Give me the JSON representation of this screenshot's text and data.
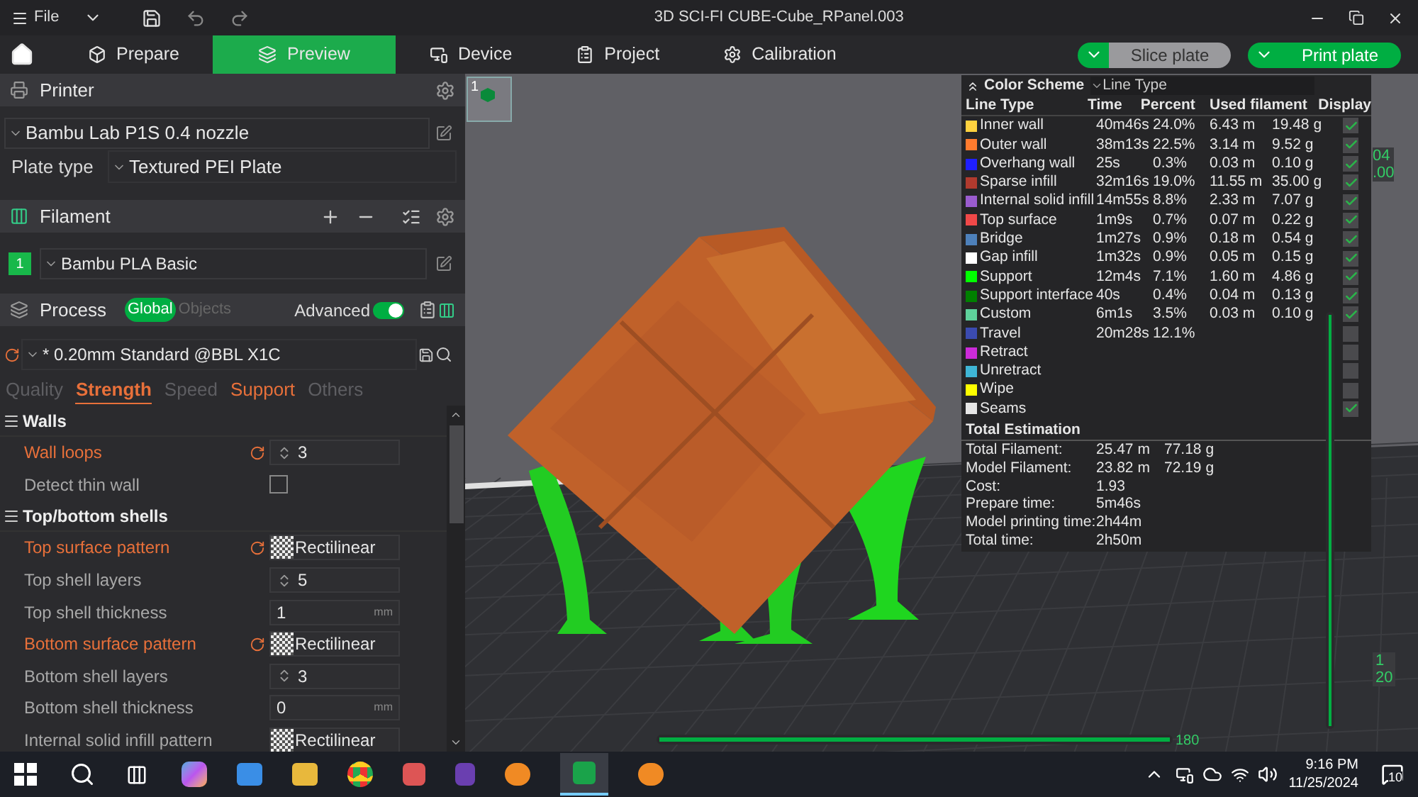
{
  "titlebar": {
    "menu": "File",
    "title": "3D SCI-FI CUBE-Cube_RPanel.003"
  },
  "tabs": [
    {
      "label": "Prepare",
      "selected": false
    },
    {
      "label": "Preview",
      "selected": true
    },
    {
      "label": "Device",
      "selected": false
    },
    {
      "label": "Project",
      "selected": false
    },
    {
      "label": "Calibration",
      "selected": false
    }
  ],
  "actions": [
    {
      "label": "Slice plate",
      "disabled": true
    },
    {
      "label": "Print plate",
      "disabled": false
    }
  ],
  "printer": {
    "title": "Printer",
    "model": "Bambu Lab P1S 0.4 nozzle",
    "plate_label": "Plate type",
    "plate_value": "Textured PEI Plate"
  },
  "filament": {
    "title": "Filament",
    "items": [
      {
        "index": "1",
        "name": "Bambu PLA Basic",
        "color": "#18b84a"
      }
    ]
  },
  "process": {
    "title": "Process",
    "scopes": [
      {
        "label": "Global",
        "selected": true
      },
      {
        "label": "Objects",
        "selected": false
      }
    ],
    "advanced_label": "Advanced",
    "advanced_on": true,
    "preset": "* 0.20mm Standard @BBL X1C"
  },
  "subtabs": [
    {
      "label": "Quality",
      "selected": false,
      "modified": false
    },
    {
      "label": "Strength",
      "selected": true,
      "modified": true
    },
    {
      "label": "Speed",
      "selected": false,
      "modified": false
    },
    {
      "label": "Support",
      "selected": false,
      "modified": true
    },
    {
      "label": "Others",
      "selected": false,
      "modified": false
    }
  ],
  "groups": [
    {
      "title": "Walls",
      "rows": [
        {
          "label": "Wall loops",
          "modified": true,
          "kind": "spin",
          "value": "3"
        },
        {
          "label": "Detect thin wall",
          "modified": false,
          "kind": "checkbox",
          "checked": false
        }
      ]
    },
    {
      "title": "Top/bottom shells",
      "rows": [
        {
          "label": "Top surface pattern",
          "modified": true,
          "kind": "pattern",
          "value": "Rectilinear"
        },
        {
          "label": "Top shell layers",
          "modified": false,
          "kind": "spin",
          "value": "5"
        },
        {
          "label": "Top shell thickness",
          "modified": false,
          "kind": "number",
          "value": "1",
          "unit": "mm"
        },
        {
          "label": "Bottom surface pattern",
          "modified": true,
          "kind": "pattern",
          "value": "Rectilinear"
        },
        {
          "label": "Bottom shell layers",
          "modified": false,
          "kind": "spin",
          "value": "3"
        },
        {
          "label": "Bottom shell thickness",
          "modified": false,
          "kind": "number",
          "value": "0",
          "unit": "mm"
        },
        {
          "label": "Internal solid infill pattern",
          "modified": false,
          "kind": "pattern",
          "value": "Rectilinear"
        }
      ]
    }
  ],
  "plate_thumb": {
    "label": "1"
  },
  "legend": {
    "title": "Color Scheme",
    "scheme": "Line Type",
    "columns": [
      "Line Type",
      "Time",
      "Percent",
      "Used filament",
      "Display"
    ],
    "rows": [
      {
        "name": "Inner wall",
        "color": "#ffd23f",
        "time": "40m46s",
        "percent": "24.0%",
        "length": "6.43 m",
        "weight": "19.48 g",
        "display": true
      },
      {
        "name": "Outer wall",
        "color": "#ff7b2e",
        "time": "38m13s",
        "percent": "22.5%",
        "length": "3.14 m",
        "weight": "9.52 g",
        "display": true
      },
      {
        "name": "Overhang wall",
        "color": "#1f1fff",
        "time": "25s",
        "percent": "0.3%",
        "length": "0.03 m",
        "weight": "0.10 g",
        "display": true
      },
      {
        "name": "Sparse infill",
        "color": "#b03a2e",
        "time": "32m16s",
        "percent": "19.0%",
        "length": "11.55 m",
        "weight": "35.00 g",
        "display": true
      },
      {
        "name": "Internal solid infill",
        "color": "#9a5ccf",
        "time": "14m55s",
        "percent": "8.8%",
        "length": "2.33 m",
        "weight": "7.07 g",
        "display": true
      },
      {
        "name": "Top surface",
        "color": "#f04848",
        "time": "1m9s",
        "percent": "0.7%",
        "length": "0.07 m",
        "weight": "0.22 g",
        "display": true
      },
      {
        "name": "Bridge",
        "color": "#4d80ba",
        "time": "1m27s",
        "percent": "0.9%",
        "length": "0.18 m",
        "weight": "0.54 g",
        "display": true
      },
      {
        "name": "Gap infill",
        "color": "#ffffff",
        "time": "1m32s",
        "percent": "0.9%",
        "length": "0.05 m",
        "weight": "0.15 g",
        "display": true
      },
      {
        "name": "Support",
        "color": "#00ff00",
        "time": "12m4s",
        "percent": "7.1%",
        "length": "1.60 m",
        "weight": "4.86 g",
        "display": true
      },
      {
        "name": "Support interface",
        "color": "#008000",
        "time": "40s",
        "percent": "0.4%",
        "length": "0.04 m",
        "weight": "0.13 g",
        "display": true
      },
      {
        "name": "Custom",
        "color": "#5ed19b",
        "time": "6m1s",
        "percent": "3.5%",
        "length": "0.03 m",
        "weight": "0.10 g",
        "display": true
      },
      {
        "name": "Travel",
        "color": "#3b4bb0",
        "time": "20m28s",
        "percent": "12.1%",
        "display": false
      },
      {
        "name": "Retract",
        "color": "#cc2bd9",
        "display": false
      },
      {
        "name": "Unretract",
        "color": "#3fb6d6",
        "display": false
      },
      {
        "name": "Wipe",
        "color": "#ffff00",
        "display": false
      },
      {
        "name": "Seams",
        "color": "#e6e6e6",
        "display": true
      }
    ],
    "total_title": "Total Estimation",
    "totals": [
      {
        "label": "Total Filament:",
        "value": "25.47 m",
        "extra": "77.18 g"
      },
      {
        "label": "Model Filament:",
        "value": "23.82 m",
        "extra": "72.19 g"
      },
      {
        "label": "Cost:",
        "value": "1.93"
      },
      {
        "label": "Prepare time:",
        "value": "5m46s"
      },
      {
        "label": "Model printing time:",
        "value": "2h44m"
      },
      {
        "label": "Total time:",
        "value": "2h50m"
      }
    ]
  },
  "layer_slider": {
    "top_labels": [
      "04",
      ".00"
    ],
    "bottom_labels": [
      "1",
      "20"
    ],
    "level": 1
  },
  "move_slider": {
    "label": "180",
    "level": 1
  },
  "taskbar": {
    "time": "9:16 PM",
    "date": "11/25/2024",
    "notifications": "10"
  }
}
